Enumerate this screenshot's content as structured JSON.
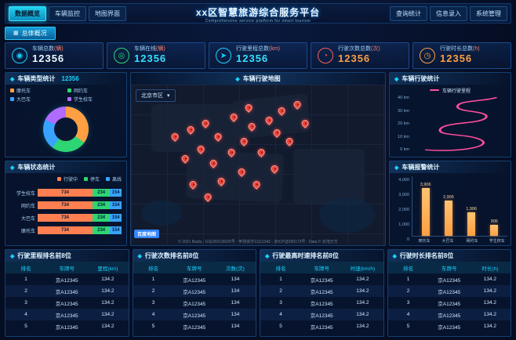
{
  "header": {
    "title": "xx区智慧旅游综合服务平台",
    "subtitle": "Comprehensive service platform for smart tourism",
    "left_nav": [
      {
        "label": "数据概览",
        "active": true
      },
      {
        "label": "车辆监控",
        "active": false
      },
      {
        "label": "地图界面",
        "active": false
      }
    ],
    "right_nav": [
      {
        "label": "查询统计",
        "active": false
      },
      {
        "label": "信息录入",
        "active": false
      },
      {
        "label": "系统管理",
        "active": false
      }
    ]
  },
  "tab": {
    "label": "总体概况",
    "icon": "grid-icon"
  },
  "stats": [
    {
      "label": "车辆总数",
      "unit": "(辆)",
      "value": "12356",
      "icon": "bus-icon",
      "glyph": "◉"
    },
    {
      "label": "车辆在线",
      "unit": "(辆)",
      "value": "12356",
      "icon": "car-icon",
      "glyph": "◎"
    },
    {
      "label": "行驶里程总数",
      "unit": "(km)",
      "value": "12356",
      "icon": "road-icon",
      "glyph": "➤"
    },
    {
      "label": "行驶次数总数",
      "unit": "(次)",
      "value": "12356",
      "icon": "counter-icon",
      "glyph": "◔"
    },
    {
      "label": "行驶时长总数",
      "unit": "(h)",
      "value": "12356",
      "icon": "clock-icon",
      "glyph": "◷"
    }
  ],
  "panels": {
    "vehicle_type": {
      "title": "车辆类型统计",
      "value": "12356",
      "chart_data": {
        "type": "pie",
        "items": [
          {
            "label": "摩托车",
            "value": 35,
            "color": "#ff9f43"
          },
          {
            "label": "网约车",
            "value": 25,
            "color": "#2ed573"
          },
          {
            "label": "大巴车",
            "value": 22,
            "color": "#38a3ff"
          },
          {
            "label": "学生校车",
            "value": 18,
            "color": "#b06bff"
          }
        ]
      }
    },
    "vehicle_status": {
      "title": "车辆状态统计",
      "chart_data": {
        "type": "bar",
        "stacked": true,
        "categories": [
          "学生校车",
          "网约车",
          "大巴车",
          "摩托车"
        ],
        "series": [
          {
            "name": "行驶中",
            "color": "#ff7f50",
            "values": [
              734,
              734,
              734,
              734
            ]
          },
          {
            "name": "停车",
            "color": "#2ed573",
            "values": [
              234,
              234,
              234,
              234
            ]
          },
          {
            "name": "离线",
            "color": "#38a3ff",
            "values": [
              154,
              154,
              154,
              154
            ]
          }
        ]
      }
    },
    "map": {
      "title": "车辆行驶地图",
      "region": "北京市区",
      "region_caret": "▾",
      "logo": "百度地图",
      "copyright": "© 2021 Baidu - GS(2021)6026号 - 甲测资字11111342 - 京ICP证030173号 - Data © 长地万方",
      "markers": [
        {
          "x": 18,
          "y": 30
        },
        {
          "x": 24,
          "y": 26
        },
        {
          "x": 30,
          "y": 22
        },
        {
          "x": 35,
          "y": 30
        },
        {
          "x": 28,
          "y": 38
        },
        {
          "x": 22,
          "y": 44
        },
        {
          "x": 33,
          "y": 47
        },
        {
          "x": 40,
          "y": 40
        },
        {
          "x": 45,
          "y": 33
        },
        {
          "x": 48,
          "y": 24
        },
        {
          "x": 55,
          "y": 20
        },
        {
          "x": 60,
          "y": 14
        },
        {
          "x": 66,
          "y": 10
        },
        {
          "x": 58,
          "y": 28
        },
        {
          "x": 63,
          "y": 33
        },
        {
          "x": 52,
          "y": 40
        },
        {
          "x": 44,
          "y": 52
        },
        {
          "x": 36,
          "y": 58
        },
        {
          "x": 50,
          "y": 60
        },
        {
          "x": 57,
          "y": 50
        },
        {
          "x": 25,
          "y": 60
        },
        {
          "x": 31,
          "y": 68
        },
        {
          "x": 47,
          "y": 12
        },
        {
          "x": 69,
          "y": 22
        },
        {
          "x": 41,
          "y": 18
        }
      ]
    },
    "drive_stats": {
      "title": "车辆行驶统计",
      "legend": "车辆行驶里程",
      "color": "#ff4f9e",
      "chart_data": {
        "type": "line",
        "ylabel": "km",
        "y_ticks": [
          "40 km",
          "30 km",
          "20 km",
          "10 km",
          "0 km"
        ],
        "ylim": [
          0,
          40
        ]
      }
    },
    "alarm_stats": {
      "title": "车辆报警统计",
      "chart_data": {
        "type": "bar",
        "categories": [
          "摩托车",
          "大巴车",
          "网约车",
          "学生校车"
        ],
        "values": [
          3906,
          2906,
          1906,
          906
        ],
        "labels": [
          "3,906",
          "2,906",
          "1,906",
          "906"
        ],
        "y_ticks": [
          "4,000",
          "3,000",
          "2,000",
          "1,000",
          "0"
        ],
        "ylim": [
          0,
          4000
        ],
        "color": "#ff9f43"
      }
    }
  },
  "tables": [
    {
      "title": "行驶里程排名前8位",
      "columns": [
        "排名",
        "车牌号",
        "里程(km)"
      ],
      "rows": [
        [
          "1",
          "京A12345",
          "134.2"
        ],
        [
          "2",
          "京A12345",
          "134.2"
        ],
        [
          "3",
          "京A12345",
          "134.2"
        ],
        [
          "4",
          "京A12345",
          "134.2"
        ],
        [
          "5",
          "京A12345",
          "134.2"
        ]
      ]
    },
    {
      "title": "行驶次数排名前8位",
      "columns": [
        "排名",
        "车牌号",
        "次数(次)"
      ],
      "rows": [
        [
          "1",
          "京A12345",
          "134"
        ],
        [
          "2",
          "京A12345",
          "134"
        ],
        [
          "3",
          "京A12345",
          "134"
        ],
        [
          "4",
          "京A12345",
          "134"
        ],
        [
          "5",
          "京A12345",
          "134"
        ]
      ]
    },
    {
      "title": "行驶最高时速排名前8位",
      "columns": [
        "排名",
        "车牌号",
        "时速(km/h)"
      ],
      "rows": [
        [
          "1",
          "京A12345",
          "134.2"
        ],
        [
          "2",
          "京A12345",
          "134.2"
        ],
        [
          "3",
          "京A12345",
          "134.2"
        ],
        [
          "4",
          "京A12345",
          "134.2"
        ],
        [
          "5",
          "京A12345",
          "134.2"
        ]
      ]
    },
    {
      "title": "行驶时长排名前8位",
      "columns": [
        "排名",
        "车牌号",
        "时长(h)"
      ],
      "rows": [
        [
          "1",
          "京A12345",
          "134.2"
        ],
        [
          "2",
          "京A12345",
          "134.2"
        ],
        [
          "3",
          "京A12345",
          "134.2"
        ],
        [
          "4",
          "京A12345",
          "134.2"
        ],
        [
          "5",
          "京A12345",
          "134.2"
        ]
      ]
    }
  ]
}
